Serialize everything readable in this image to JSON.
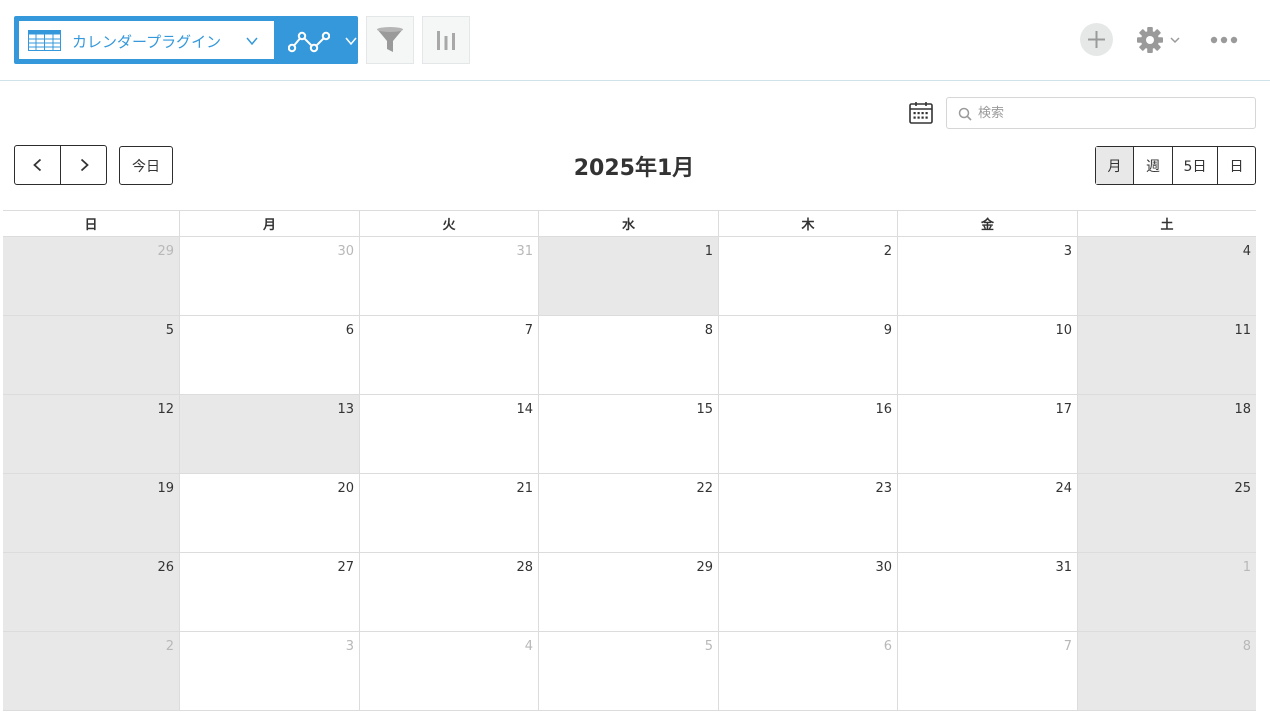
{
  "toolbar": {
    "view_name": "カレンダープラグイン",
    "accent_color": "#3498db",
    "icons": {
      "view_list": "table-icon",
      "graph": "line-graph-icon",
      "filter": "funnel-icon",
      "chart": "bar-chart-icon",
      "add": "plus-icon",
      "settings": "gear-icon",
      "more": "ellipsis-icon"
    }
  },
  "calendar": {
    "title": "2025年1月",
    "today_label": "今日",
    "search_placeholder": "検索",
    "range_buttons": [
      "月",
      "週",
      "5日",
      "日"
    ],
    "active_range": "月",
    "weekdays": [
      "日",
      "月",
      "火",
      "水",
      "木",
      "金",
      "土"
    ],
    "weeks": [
      [
        {
          "d": "29",
          "o": true,
          "g": true
        },
        {
          "d": "30",
          "o": true
        },
        {
          "d": "31",
          "o": true
        },
        {
          "d": "1",
          "g": true
        },
        {
          "d": "2"
        },
        {
          "d": "3"
        },
        {
          "d": "4",
          "g": true
        }
      ],
      [
        {
          "d": "5",
          "g": true
        },
        {
          "d": "6"
        },
        {
          "d": "7"
        },
        {
          "d": "8"
        },
        {
          "d": "9"
        },
        {
          "d": "10"
        },
        {
          "d": "11",
          "g": true
        }
      ],
      [
        {
          "d": "12",
          "g": true
        },
        {
          "d": "13",
          "g": true
        },
        {
          "d": "14"
        },
        {
          "d": "15"
        },
        {
          "d": "16"
        },
        {
          "d": "17"
        },
        {
          "d": "18",
          "g": true
        }
      ],
      [
        {
          "d": "19",
          "g": true
        },
        {
          "d": "20"
        },
        {
          "d": "21"
        },
        {
          "d": "22"
        },
        {
          "d": "23"
        },
        {
          "d": "24"
        },
        {
          "d": "25",
          "g": true
        }
      ],
      [
        {
          "d": "26",
          "g": true
        },
        {
          "d": "27"
        },
        {
          "d": "28"
        },
        {
          "d": "29"
        },
        {
          "d": "30"
        },
        {
          "d": "31"
        },
        {
          "d": "1",
          "o": true,
          "g": true
        }
      ],
      [
        {
          "d": "2",
          "o": true,
          "g": true
        },
        {
          "d": "3",
          "o": true
        },
        {
          "d": "4",
          "o": true
        },
        {
          "d": "5",
          "o": true
        },
        {
          "d": "6",
          "o": true
        },
        {
          "d": "7",
          "o": true
        },
        {
          "d": "8",
          "o": true,
          "g": true
        }
      ]
    ]
  }
}
